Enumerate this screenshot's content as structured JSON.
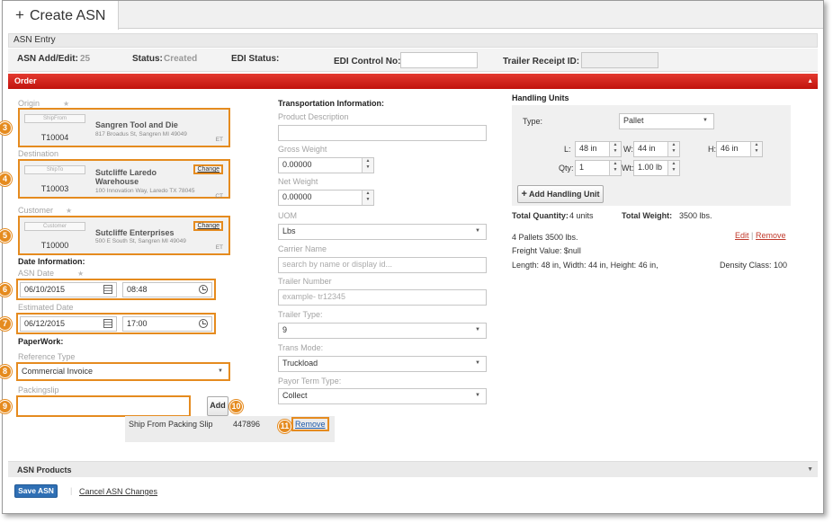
{
  "tab": {
    "icon": "plus-icon",
    "label": "Create ASN"
  },
  "entry": {
    "title": "ASN Entry"
  },
  "info": {
    "asn_label": "ASN Add/Edit:",
    "asn_value": "25",
    "status_label": "Status:",
    "status_value": "Created",
    "edi_status_label": "EDI Status:",
    "edi_control_label": "EDI Control No:",
    "edi_control_value": "",
    "trailer_receipt_label": "Trailer Receipt ID:",
    "trailer_receipt_value": ""
  },
  "order": {
    "title": "Order"
  },
  "origin": {
    "label": "Origin",
    "pill": "ShipFrom",
    "code": "T10004",
    "name": "Sangren Tool and Die",
    "address": "817 Broadus St, Sangren MI 49049",
    "tz": "ET"
  },
  "destination": {
    "label": "Destination",
    "pill": "ShipTo",
    "code": "T10003",
    "name_line1": "Sutcliffe Laredo",
    "name_line2": "Warehouse",
    "address": "100 Innovation Way, Laredo TX 78045",
    "tz": "CT",
    "change": "Change"
  },
  "customer": {
    "label": "Customer",
    "pill": "Customer",
    "code": "T10000",
    "name": "Sutcliffe Enterprises",
    "address": "500 E South St, Sangren MI 49049",
    "tz": "ET",
    "change": "Change"
  },
  "dates": {
    "section": "Date Information:",
    "asn_date_label": "ASN Date",
    "asn_date": "06/10/2015",
    "asn_time": "08:48",
    "est_date_label": "Estimated Date",
    "est_date": "06/12/2015",
    "est_time": "17:00"
  },
  "paperwork": {
    "section": "PaperWork:",
    "ref_type_label": "Reference Type",
    "ref_type": "Commercial Invoice",
    "packingslip_label": "Packingslip",
    "packingslip_value": "",
    "add": "Add",
    "row_type": "Ship From Packing Slip",
    "row_value": "447896",
    "remove": "Remove"
  },
  "badges": [
    "3",
    "4",
    "5",
    "6",
    "7",
    "8",
    "9",
    "10",
    "11"
  ],
  "transport": {
    "section": "Transportation Information:",
    "product_desc_label": "Product Description",
    "product_desc": "",
    "gross_weight_label": "Gross Weight",
    "gross_weight": "0.00000",
    "net_weight_label": "Net Weight",
    "net_weight": "0.00000",
    "uom_label": "UOM",
    "uom": "Lbs",
    "carrier_label": "Carrier Name",
    "carrier_placeholder": "search by name or display id...",
    "trailer_num_label": "Trailer Number",
    "trailer_num_placeholder": "example- tr12345",
    "trailer_type_label": "Trailer Type:",
    "trailer_type": "9",
    "trans_mode_label": "Trans Mode:",
    "trans_mode": "Truckload",
    "payor_label": "Payor Term Type:",
    "payor": "Collect"
  },
  "handling": {
    "section": "Handling Units",
    "type_label": "Type:",
    "type": "Pallet",
    "l_label": "L:",
    "l": "48 in",
    "w_label": "W:",
    "w": "44 in",
    "h_label": "H:",
    "h": "46 in",
    "qty_label": "Qty:",
    "qty": "1",
    "wt_label": "Wt:",
    "wt": "1.00 lb",
    "add_button": "Add Handling Unit",
    "total_qty_label": "Total Quantity:",
    "total_qty": "4 units",
    "total_wt_label": "Total Weight:",
    "total_wt": "3500 lbs.",
    "line1": "4 Pallets 3500 lbs.",
    "edit": "Edit",
    "remove": "Remove",
    "freight": "Freight Value: $null",
    "dims": "Length: 48 in, Width: 44 in, Height: 46 in,",
    "density": "Density Class: 100"
  },
  "products": {
    "title": "ASN Products"
  },
  "footer": {
    "save": "Save ASN",
    "cancel": "Cancel ASN Changes"
  },
  "colors": {
    "accent": "#c0130d",
    "highlight": "#e58b1f",
    "primary": "#2f6fb4"
  }
}
